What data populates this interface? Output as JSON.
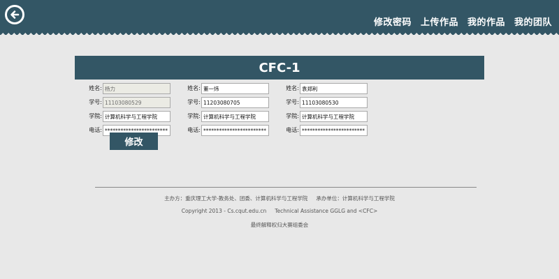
{
  "header": {
    "back_icon": "arrow-left-circle-icon",
    "nav": [
      "修改密码",
      "上传作品",
      "我的作品",
      "我的团队"
    ]
  },
  "team": {
    "title": "CFC-1",
    "members": [
      {
        "name_label": "姓名:",
        "name": "杨力",
        "id_label": "学号:",
        "id": "11103080529",
        "college_label": "学院:",
        "college": "计算机科学与工程学院",
        "phone_label": "电话:",
        "phone": "************************"
      },
      {
        "name_label": "姓名:",
        "name": "董一炜",
        "id_label": "学号:",
        "id": "11203080705",
        "college_label": "学院:",
        "college": "计算机科学与工程学院",
        "phone_label": "电话:",
        "phone": "************************"
      },
      {
        "name_label": "姓名:",
        "name": "袁郑利",
        "id_label": "学号:",
        "id": "11103080530",
        "college_label": "学院:",
        "college": "计算机科学与工程学院",
        "phone_label": "电话:",
        "phone": "************************"
      }
    ],
    "edit_label": "修改"
  },
  "footer": {
    "organizer": "主办方：重庆理工大学-教务处、团委、计算机科学与工程学院",
    "undertaker": "承办单位：计算机科学与工程学院",
    "copyright": "Copyright 2013 - Cs.cqut.edu.cn",
    "tech": "Technical Assistance GGLG and <CFC>",
    "rights": "最终解释权归大赛组委会"
  },
  "colors": {
    "primary": "#335665",
    "background": "#e8e8e8"
  }
}
